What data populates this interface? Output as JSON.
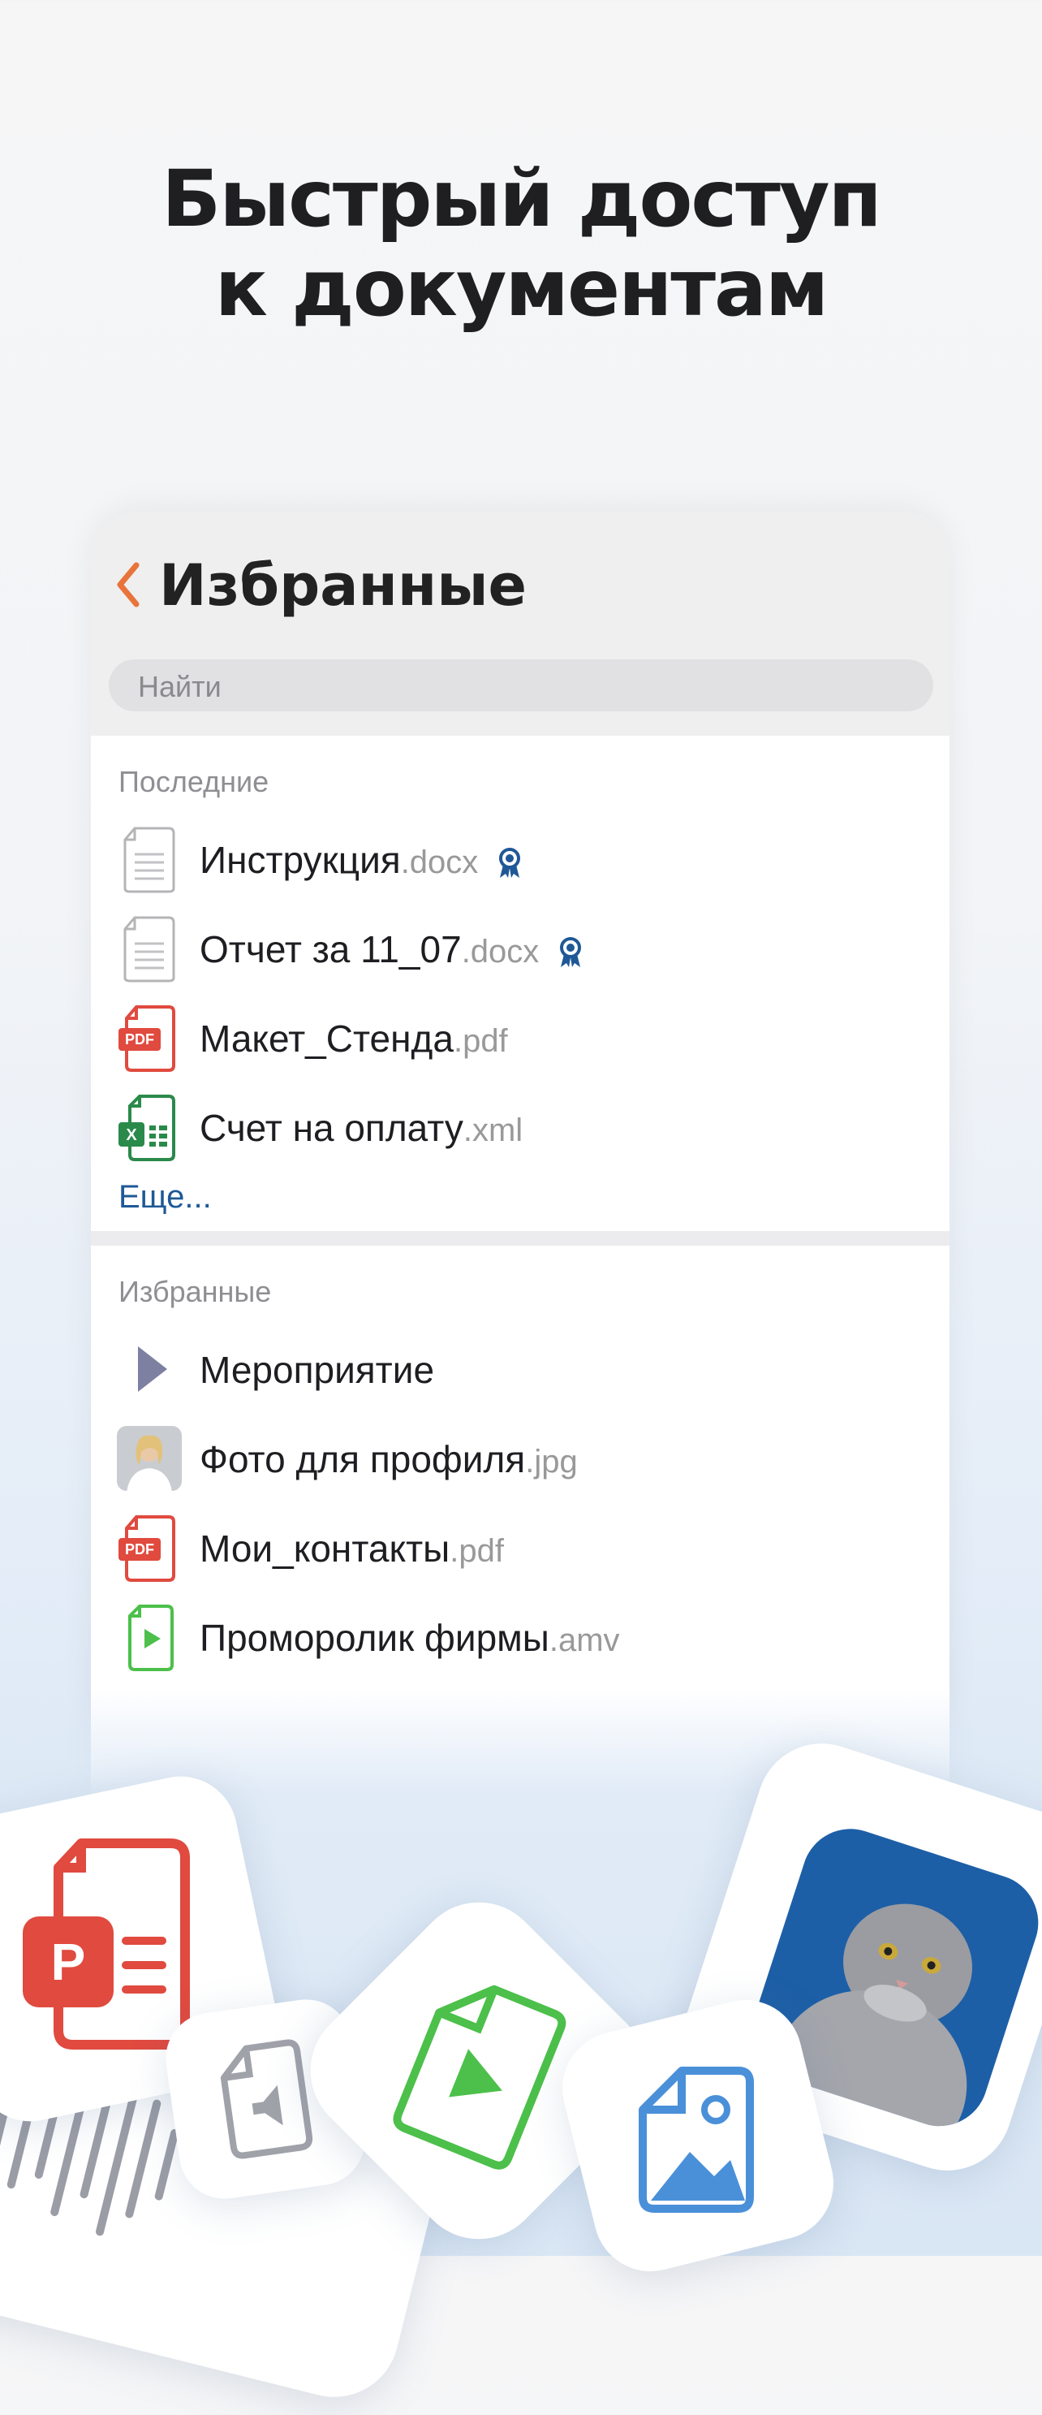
{
  "headline": {
    "line1": "Быстрый доступ",
    "line2": "к документам"
  },
  "screen": {
    "title": "Избранные",
    "search_placeholder": "Найти"
  },
  "recent": {
    "label": "Последние",
    "items": [
      {
        "name": "Инструкция",
        "ext": ".docx",
        "icon": "doc-icon",
        "badge": true
      },
      {
        "name": "Отчет за 11_07",
        "ext": ".docx",
        "icon": "doc-icon",
        "badge": true
      },
      {
        "name": "Макет_Стенда",
        "ext": ".pdf",
        "icon": "pdf-icon",
        "badge": false
      },
      {
        "name": "Счет на оплату",
        "ext": ".xml",
        "icon": "excel-icon",
        "badge": false
      }
    ],
    "more": "Еще..."
  },
  "favorites": {
    "label": "Избранные",
    "items": [
      {
        "name": "Мероприятие",
        "ext": "",
        "icon": "folder-arrow-icon"
      },
      {
        "name": "Фото для профиля",
        "ext": ".jpg",
        "icon": "photo-thumbnail"
      },
      {
        "name": "Мои_контакты",
        "ext": ".pdf",
        "icon": "pdf-icon"
      },
      {
        "name": "Проморолик фирмы",
        "ext": ".amv",
        "icon": "video-icon"
      }
    ]
  },
  "pdf_icon_label": "PDF",
  "ppt_icon_label": "P",
  "colors": {
    "accent_back": "#e8743b",
    "link": "#1f5896",
    "pdf_red": "#e04a3f",
    "excel_green": "#2a8a4a",
    "video_green": "#4cc04a",
    "image_blue": "#4a90d9"
  }
}
